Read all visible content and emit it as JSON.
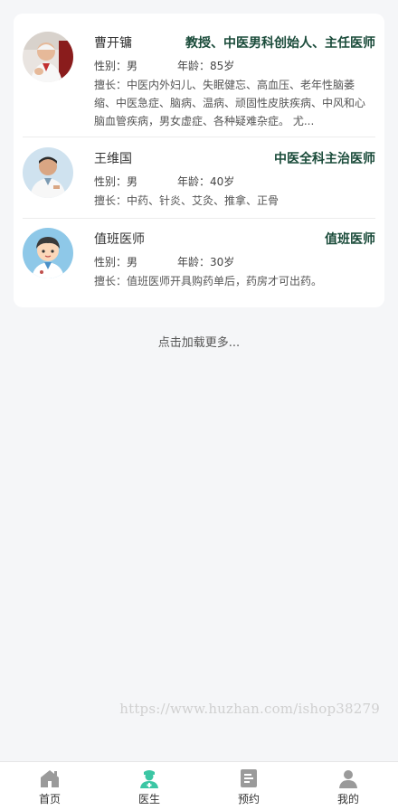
{
  "doctors": [
    {
      "name": "曹开镛",
      "title": "教授、中医男科创始人、主任医师",
      "sex": "性别：男",
      "age": "年龄：85岁",
      "skill": "擅长：中医内外妇儿、失眠健忘、高血压、老年性脑萎缩、中医急症、脑病、温病、顽固性皮肤疾病、中风和心脑血管疾病，男女虚症、各种疑难杂症。 尤..."
    },
    {
      "name": "王维国",
      "title": "中医全科主治医师",
      "sex": "性别：男",
      "age": "年龄：40岁",
      "skill": "擅长：中药、针炎、艾灸、推拿、正骨"
    },
    {
      "name": "值班医师",
      "title": "值班医师",
      "sex": "性别：男",
      "age": "年龄：30岁",
      "skill": "擅长：值班医师开具购药单后，药房才可出药。"
    }
  ],
  "load_more": "点击加载更多...",
  "watermark": "https://www.huzhan.com/ishop38279",
  "tabbar": {
    "items": [
      {
        "label": "首页",
        "icon": "home-icon",
        "active": false
      },
      {
        "label": "医生",
        "icon": "doctor-icon",
        "active": true
      },
      {
        "label": "预约",
        "icon": "appointment-icon",
        "active": false
      },
      {
        "label": "我的",
        "icon": "profile-icon",
        "active": false
      }
    ]
  },
  "colors": {
    "title": "#1a4b3a",
    "active_tab": "#3cc6a4",
    "inactive_tab": "#9a9a9a",
    "background": "#f5f6f8"
  }
}
